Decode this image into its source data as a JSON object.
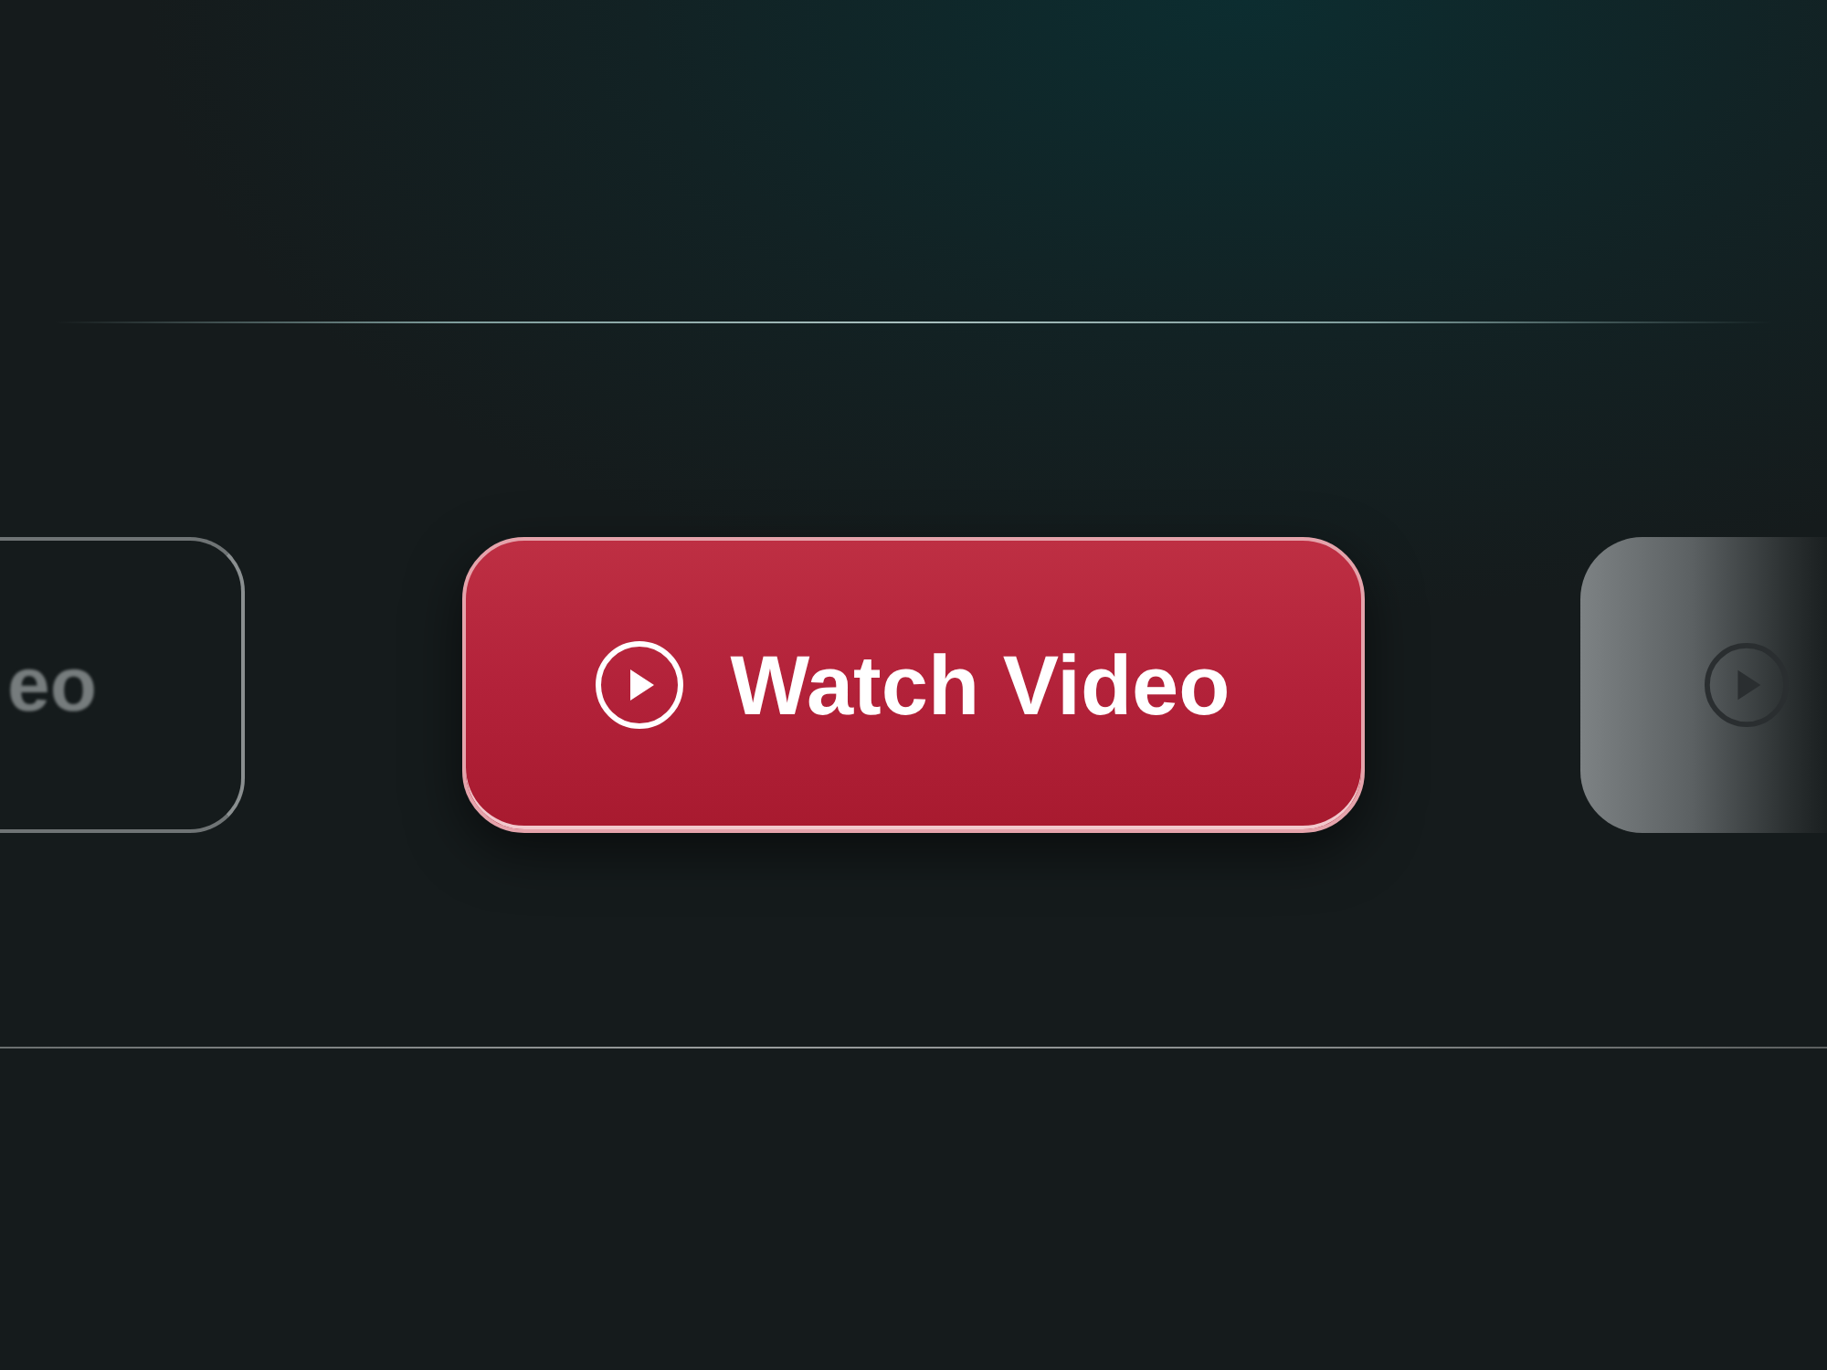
{
  "buttons": [
    {
      "kind": "outline",
      "label": "eo"
    },
    {
      "kind": "primary",
      "label": "Watch Video"
    },
    {
      "kind": "filled"
    }
  ]
}
